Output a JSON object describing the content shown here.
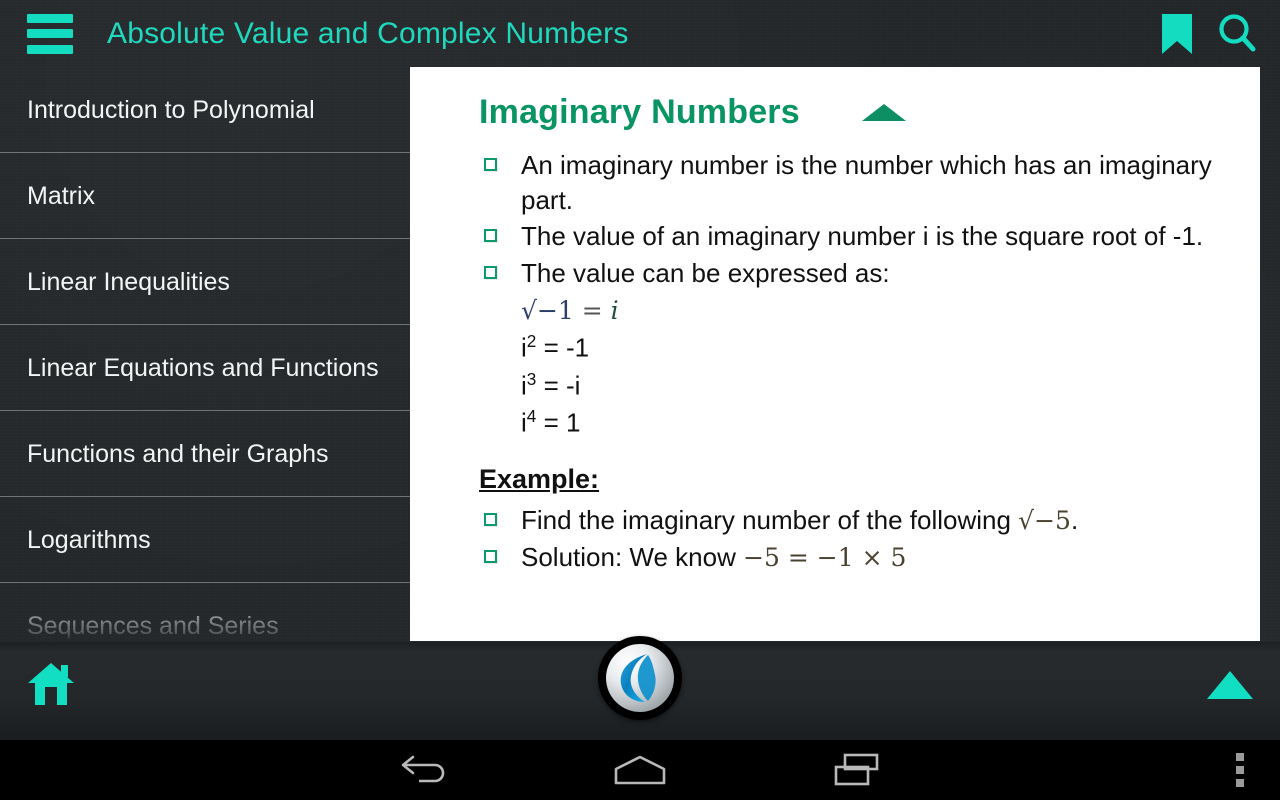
{
  "header": {
    "title": "Absolute Value and Complex Numbers",
    "menu_icon": "hamburger-menu-icon",
    "bookmark_icon": "bookmark-icon",
    "search_icon": "search-icon",
    "accent_color": "#1fd8bd",
    "background_color": "#24282a"
  },
  "sidebar": {
    "items": [
      {
        "label": "Introduction to Polynomial"
      },
      {
        "label": "Matrix"
      },
      {
        "label": "Linear Inequalities"
      },
      {
        "label": "Linear Equations and Functions"
      },
      {
        "label": "Functions and their Graphs"
      },
      {
        "label": "Logarithms"
      },
      {
        "label": "Sequences and Series"
      }
    ]
  },
  "content": {
    "title": "Imaginary Numbers",
    "title_color": "#089463",
    "collapse_icon": "triangle-up-icon",
    "bullets": [
      "An imaginary number is the number which has an imaginary part.",
      "The value of an imaginary number i is the square root of -1.",
      "The value can be expressed as:"
    ],
    "formulas": {
      "radical_identity": {
        "radical_sign": "√",
        "radicand": "−1",
        "equals": "=",
        "result": "i"
      },
      "powers": [
        {
          "base": "i",
          "exponent": "2",
          "equals": "=",
          "value": "-1"
        },
        {
          "base": "i",
          "exponent": "3",
          "equals": "=",
          "value": "-i"
        },
        {
          "base": "i",
          "exponent": "4",
          "equals": "=",
          "value": "1"
        }
      ]
    },
    "example_heading": "Example:",
    "example_bullets": [
      {
        "text_before": "Find the imaginary number of the following ",
        "math_radical": "√",
        "math_radicand": "−5",
        "text_after": "."
      },
      {
        "text_before": "Solution: We know ",
        "math_expression": "−5 = −1 × 5"
      }
    ]
  },
  "bottom_toolbar": {
    "home_icon": "home-icon",
    "app_logo_icon": "app-logo-icon",
    "scroll_up_icon": "triangle-up-icon",
    "accent_color": "#11dec2"
  },
  "navbar": {
    "back_icon": "back-arrow-icon",
    "home_icon": "home-pentagon-icon",
    "recents_icon": "recent-apps-icon",
    "overflow_icon": "overflow-menu-icon"
  }
}
